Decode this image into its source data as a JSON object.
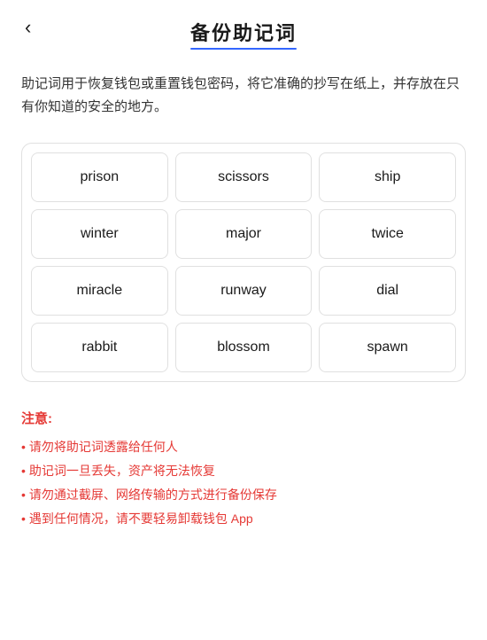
{
  "header": {
    "back_label": "‹",
    "title": "备份助记词",
    "title_underline_color": "#3366ff"
  },
  "description": {
    "text": "助记词用于恢复钱包或重置钱包密码，将它准确的抄写在纸上，并存放在只有你知道的安全的地方。"
  },
  "mnemonic_grid": {
    "words": [
      "prison",
      "scissors",
      "ship",
      "winter",
      "major",
      "twice",
      "miracle",
      "runway",
      "dial",
      "rabbit",
      "blossom",
      "spawn"
    ]
  },
  "notice": {
    "title": "注意:",
    "items": [
      "请勿将助记词透露给任何人",
      "助记词一旦丢失，资产将无法恢复",
      "请勿通过截屏、网络传输的方式进行备份保存",
      "遇到任何情况，请不要轻易卸载钱包 App"
    ]
  }
}
